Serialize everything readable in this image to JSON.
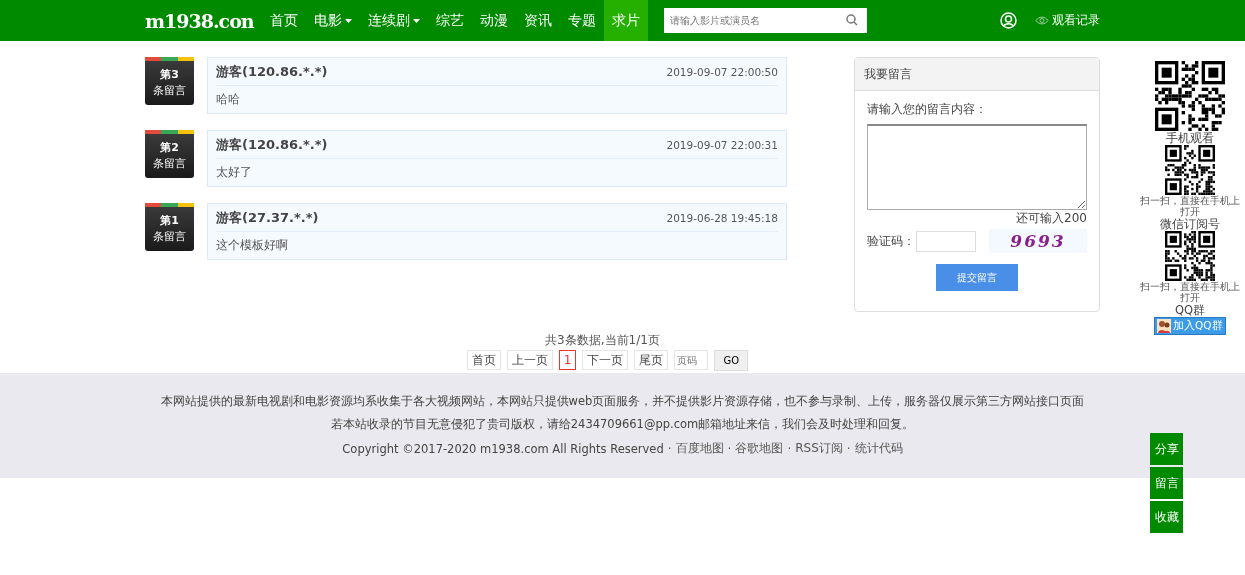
{
  "nav": {
    "logo": "m1938.con",
    "items": [
      {
        "label": "首页",
        "dropdown": false,
        "selected": false
      },
      {
        "label": "电影",
        "dropdown": true,
        "selected": false
      },
      {
        "label": "连续剧",
        "dropdown": true,
        "selected": false
      },
      {
        "label": "综艺",
        "dropdown": false,
        "selected": false
      },
      {
        "label": "动漫",
        "dropdown": false,
        "selected": false
      },
      {
        "label": "资讯",
        "dropdown": false,
        "selected": false
      },
      {
        "label": "专题",
        "dropdown": false,
        "selected": false
      },
      {
        "label": "求片",
        "dropdown": false,
        "selected": true
      }
    ],
    "search": {
      "placeholder": "请输入影片或演员名"
    },
    "history": "观看记录"
  },
  "messages": [
    {
      "number": "第3",
      "suffix": "条留言",
      "author": "游客(120.86.*.*)",
      "time": "2019-09-07 22:00:50",
      "text": "哈哈"
    },
    {
      "number": "第2",
      "suffix": "条留言",
      "author": "游客(120.86.*.*)",
      "time": "2019-09-07 22:00:31",
      "text": "太好了"
    },
    {
      "number": "第1",
      "suffix": "条留言",
      "author": "游客(27.37.*.*)",
      "time": "2019-06-28 19:45:18",
      "text": "这个模板好啊"
    }
  ],
  "form": {
    "title": "我要留言",
    "prompt": "请输入您的留言内容：",
    "remaining": "还可输入200",
    "captcha_label": "验证码：",
    "captcha": "9693",
    "submit": "提交留言"
  },
  "pagination": {
    "summary": "共3条数据,当前1/1页",
    "pages": [
      {
        "label": "首页",
        "selected": false
      },
      {
        "label": "上一页",
        "selected": false
      },
      {
        "label": "1",
        "selected": true
      },
      {
        "label": "下一页",
        "selected": false
      },
      {
        "label": "尾页",
        "selected": false
      }
    ],
    "page_placeholder": "页码",
    "go": "GO"
  },
  "footer": {
    "lines": [
      "本网站提供的最新电视剧和电影资源均系收集于各大视频网站，本网站只提供web页面服务，并不提供影片资源存储，也不参与录制、上传，服务器仅展示第三方网站接口页面",
      "若本站收录的节目无意侵犯了贵司版权，请给2434709661@pp.com邮箱地址来信，我们会及时处理和回复。"
    ],
    "copyright": "Copyright ©2017-2020 m1938.com All Rights Reserved",
    "separator": "·",
    "links": [
      "百度地图",
      "谷歌地图",
      "RSS订阅",
      "统计代码"
    ]
  },
  "side": {
    "qr_blocks": [
      {
        "label": "手机观看"
      },
      {
        "caption": "扫一扫，直接在手机上打开",
        "label": "微信订阅号"
      },
      {
        "caption": "扫一扫，直接在手机上打开",
        "label": "QQ群"
      }
    ],
    "qq_button": "加入QQ群"
  },
  "float_buttons": [
    "分享",
    "留言",
    "收藏"
  ]
}
